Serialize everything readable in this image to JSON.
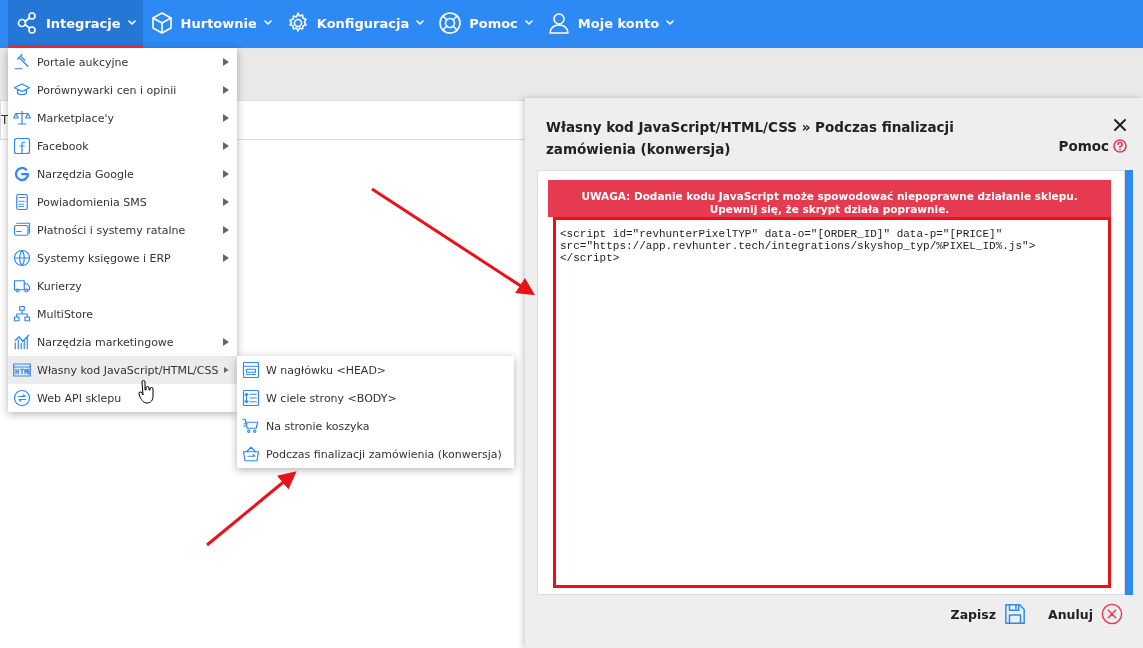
{
  "navbar": {
    "items": [
      {
        "label": "Integracje",
        "kind": "share",
        "selected": true
      },
      {
        "label": "Hurtownie",
        "kind": "box",
        "selected": false
      },
      {
        "label": "Konfiguracja",
        "kind": "gear",
        "selected": false
      },
      {
        "label": "Pomoc",
        "kind": "lifebuoy",
        "selected": false
      },
      {
        "label": "Moje konto",
        "kind": "user",
        "selected": false
      }
    ]
  },
  "background": {
    "cut_text": "T"
  },
  "menu": {
    "items": [
      {
        "label": "Portale aukcyjne",
        "kind": "gavel",
        "has_submenu": true,
        "selected": false
      },
      {
        "label": "Porównywarki cen i opinii",
        "kind": "cap",
        "has_submenu": true,
        "selected": false
      },
      {
        "label": "Marketplace'y",
        "kind": "scales",
        "has_submenu": true,
        "selected": false
      },
      {
        "label": "Facebook",
        "kind": "facebook",
        "has_submenu": true,
        "selected": false
      },
      {
        "label": "Narzędzia Google",
        "kind": "google",
        "has_submenu": true,
        "selected": false
      },
      {
        "label": "Powiadomienia SMS",
        "kind": "phone",
        "has_submenu": true,
        "selected": false
      },
      {
        "label": "Płatności i systemy ratalne",
        "kind": "card",
        "has_submenu": true,
        "selected": false
      },
      {
        "label": "Systemy księgowe i ERP",
        "kind": "globe",
        "has_submenu": true,
        "selected": false
      },
      {
        "label": "Kurierzy",
        "kind": "truck",
        "has_submenu": false,
        "selected": false
      },
      {
        "label": "MultiStore",
        "kind": "network",
        "has_submenu": false,
        "selected": false
      },
      {
        "label": "Narzędzia marketingowe",
        "kind": "chart",
        "has_submenu": true,
        "selected": false
      },
      {
        "label": "Własny kod JavaScript/HTML/CSS",
        "kind": "html",
        "has_submenu": true,
        "selected": true
      },
      {
        "label": "Web API sklepu",
        "kind": "sync",
        "has_submenu": false,
        "selected": false
      }
    ]
  },
  "submenu": {
    "items": [
      {
        "label": "W nagłówku <HEAD>",
        "kind": "layout"
      },
      {
        "label": "W ciele strony <BODY>",
        "kind": "list"
      },
      {
        "label": "Na stronie koszyka",
        "kind": "cart"
      },
      {
        "label": "Podczas finalizacji zamówienia (konwersja)",
        "kind": "basket"
      }
    ]
  },
  "panel": {
    "title": "Własny kod JavaScript/HTML/CSS » Podczas finalizacji zamówienia (konwersja)",
    "help": "Pomoc",
    "warning": "UWAGA: Dodanie kodu JavaScript może spowodować niepoprawne działanie sklepu. Upewnij się, że skrypt działa poprawnie.",
    "code": "<script id=\"revhunterPixelTYP\" data-o=\"[ORDER_ID]\" data-p=\"[PRICE]\" src=\"https://app.revhunter.tech/integrations/skyshop_typ/%PIXEL_ID%.js\">\n</script>",
    "save": "Zapisz",
    "cancel": "Anuluj"
  }
}
